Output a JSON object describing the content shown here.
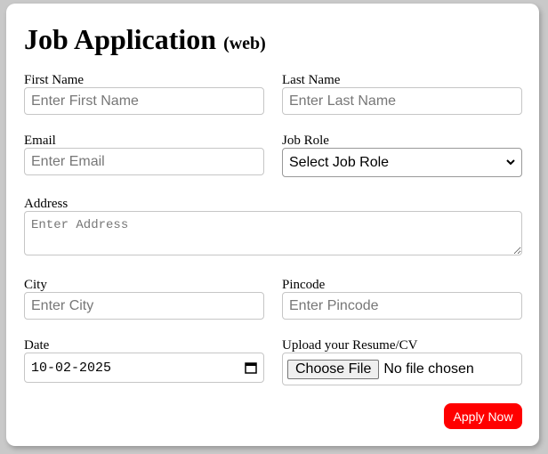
{
  "title": "Job Application",
  "title_suffix": "(web)",
  "fields": {
    "first_name": {
      "label": "First Name",
      "placeholder": "Enter First Name"
    },
    "last_name": {
      "label": "Last Name",
      "placeholder": "Enter Last Name"
    },
    "email": {
      "label": "Email",
      "placeholder": "Enter Email"
    },
    "job_role": {
      "label": "Job Role",
      "value": "Select Job Role"
    },
    "address": {
      "label": "Address",
      "placeholder": "Enter Address"
    },
    "city": {
      "label": "City",
      "placeholder": "Enter City"
    },
    "pincode": {
      "label": "Pincode",
      "placeholder": "Enter Pincode"
    },
    "date": {
      "label": "Date",
      "value": "10-02-2025"
    },
    "resume": {
      "label": "Upload your Resume/CV",
      "button": "Choose File",
      "status": "No file chosen"
    }
  },
  "submit_label": "Apply Now",
  "colors": {
    "accent": "#ff0000",
    "background": "#c9c9c9"
  }
}
